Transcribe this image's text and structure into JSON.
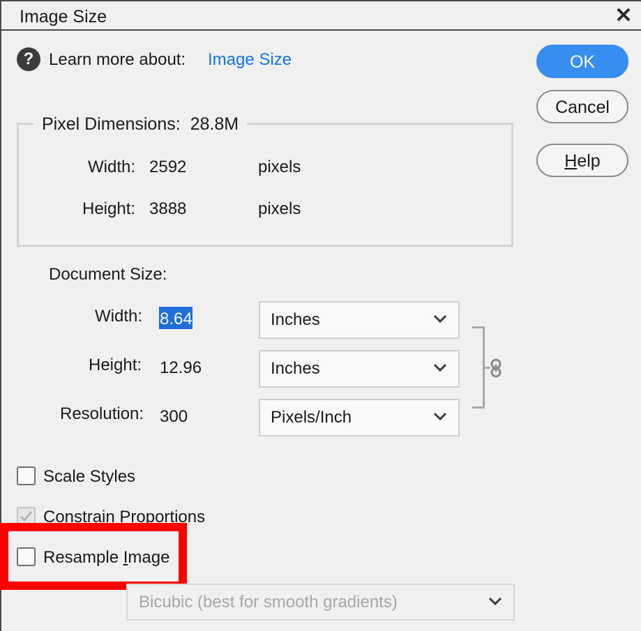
{
  "window": {
    "title": "Image Size",
    "close_glyph": "✕"
  },
  "learn": {
    "text": "Learn more about:",
    "link": "Image Size",
    "icon": "question-circle-icon"
  },
  "buttons": {
    "ok": "OK",
    "cancel": "Cancel",
    "help_prefix": "",
    "help_underlined": "H",
    "help_rest": "elp"
  },
  "pixel_dimensions": {
    "title": "Pixel Dimensions:",
    "size": "28.8M",
    "width_label": "Width:",
    "width_value": "2592",
    "width_unit": "pixels",
    "height_label": "Height:",
    "height_value": "3888",
    "height_unit": "pixels"
  },
  "document_size": {
    "title": "Document Size:",
    "width_label": "Width:",
    "width_value": "8.64",
    "width_unit": "Inches",
    "height_label": "Height:",
    "height_value": "12.96",
    "height_unit": "Inches",
    "resolution_label": "Resolution:",
    "resolution_value": "300",
    "resolution_unit": "Pixels/Inch"
  },
  "options": {
    "scale_styles": {
      "label": "Scale Styles",
      "checked": false
    },
    "constrain": {
      "label": "Constrain Proportions",
      "checked": true,
      "disabled": true
    },
    "resample_before": "Resample ",
    "resample_underlined": "I",
    "resample_after": "mage",
    "resample_checked": false
  },
  "resample_method": {
    "value": "Bicubic (best for smooth gradients)",
    "disabled": true
  },
  "colors": {
    "accent": "#378ef0",
    "link": "#1473e6",
    "highlight": "#1e6fd9",
    "annotation": "#ff0000"
  }
}
